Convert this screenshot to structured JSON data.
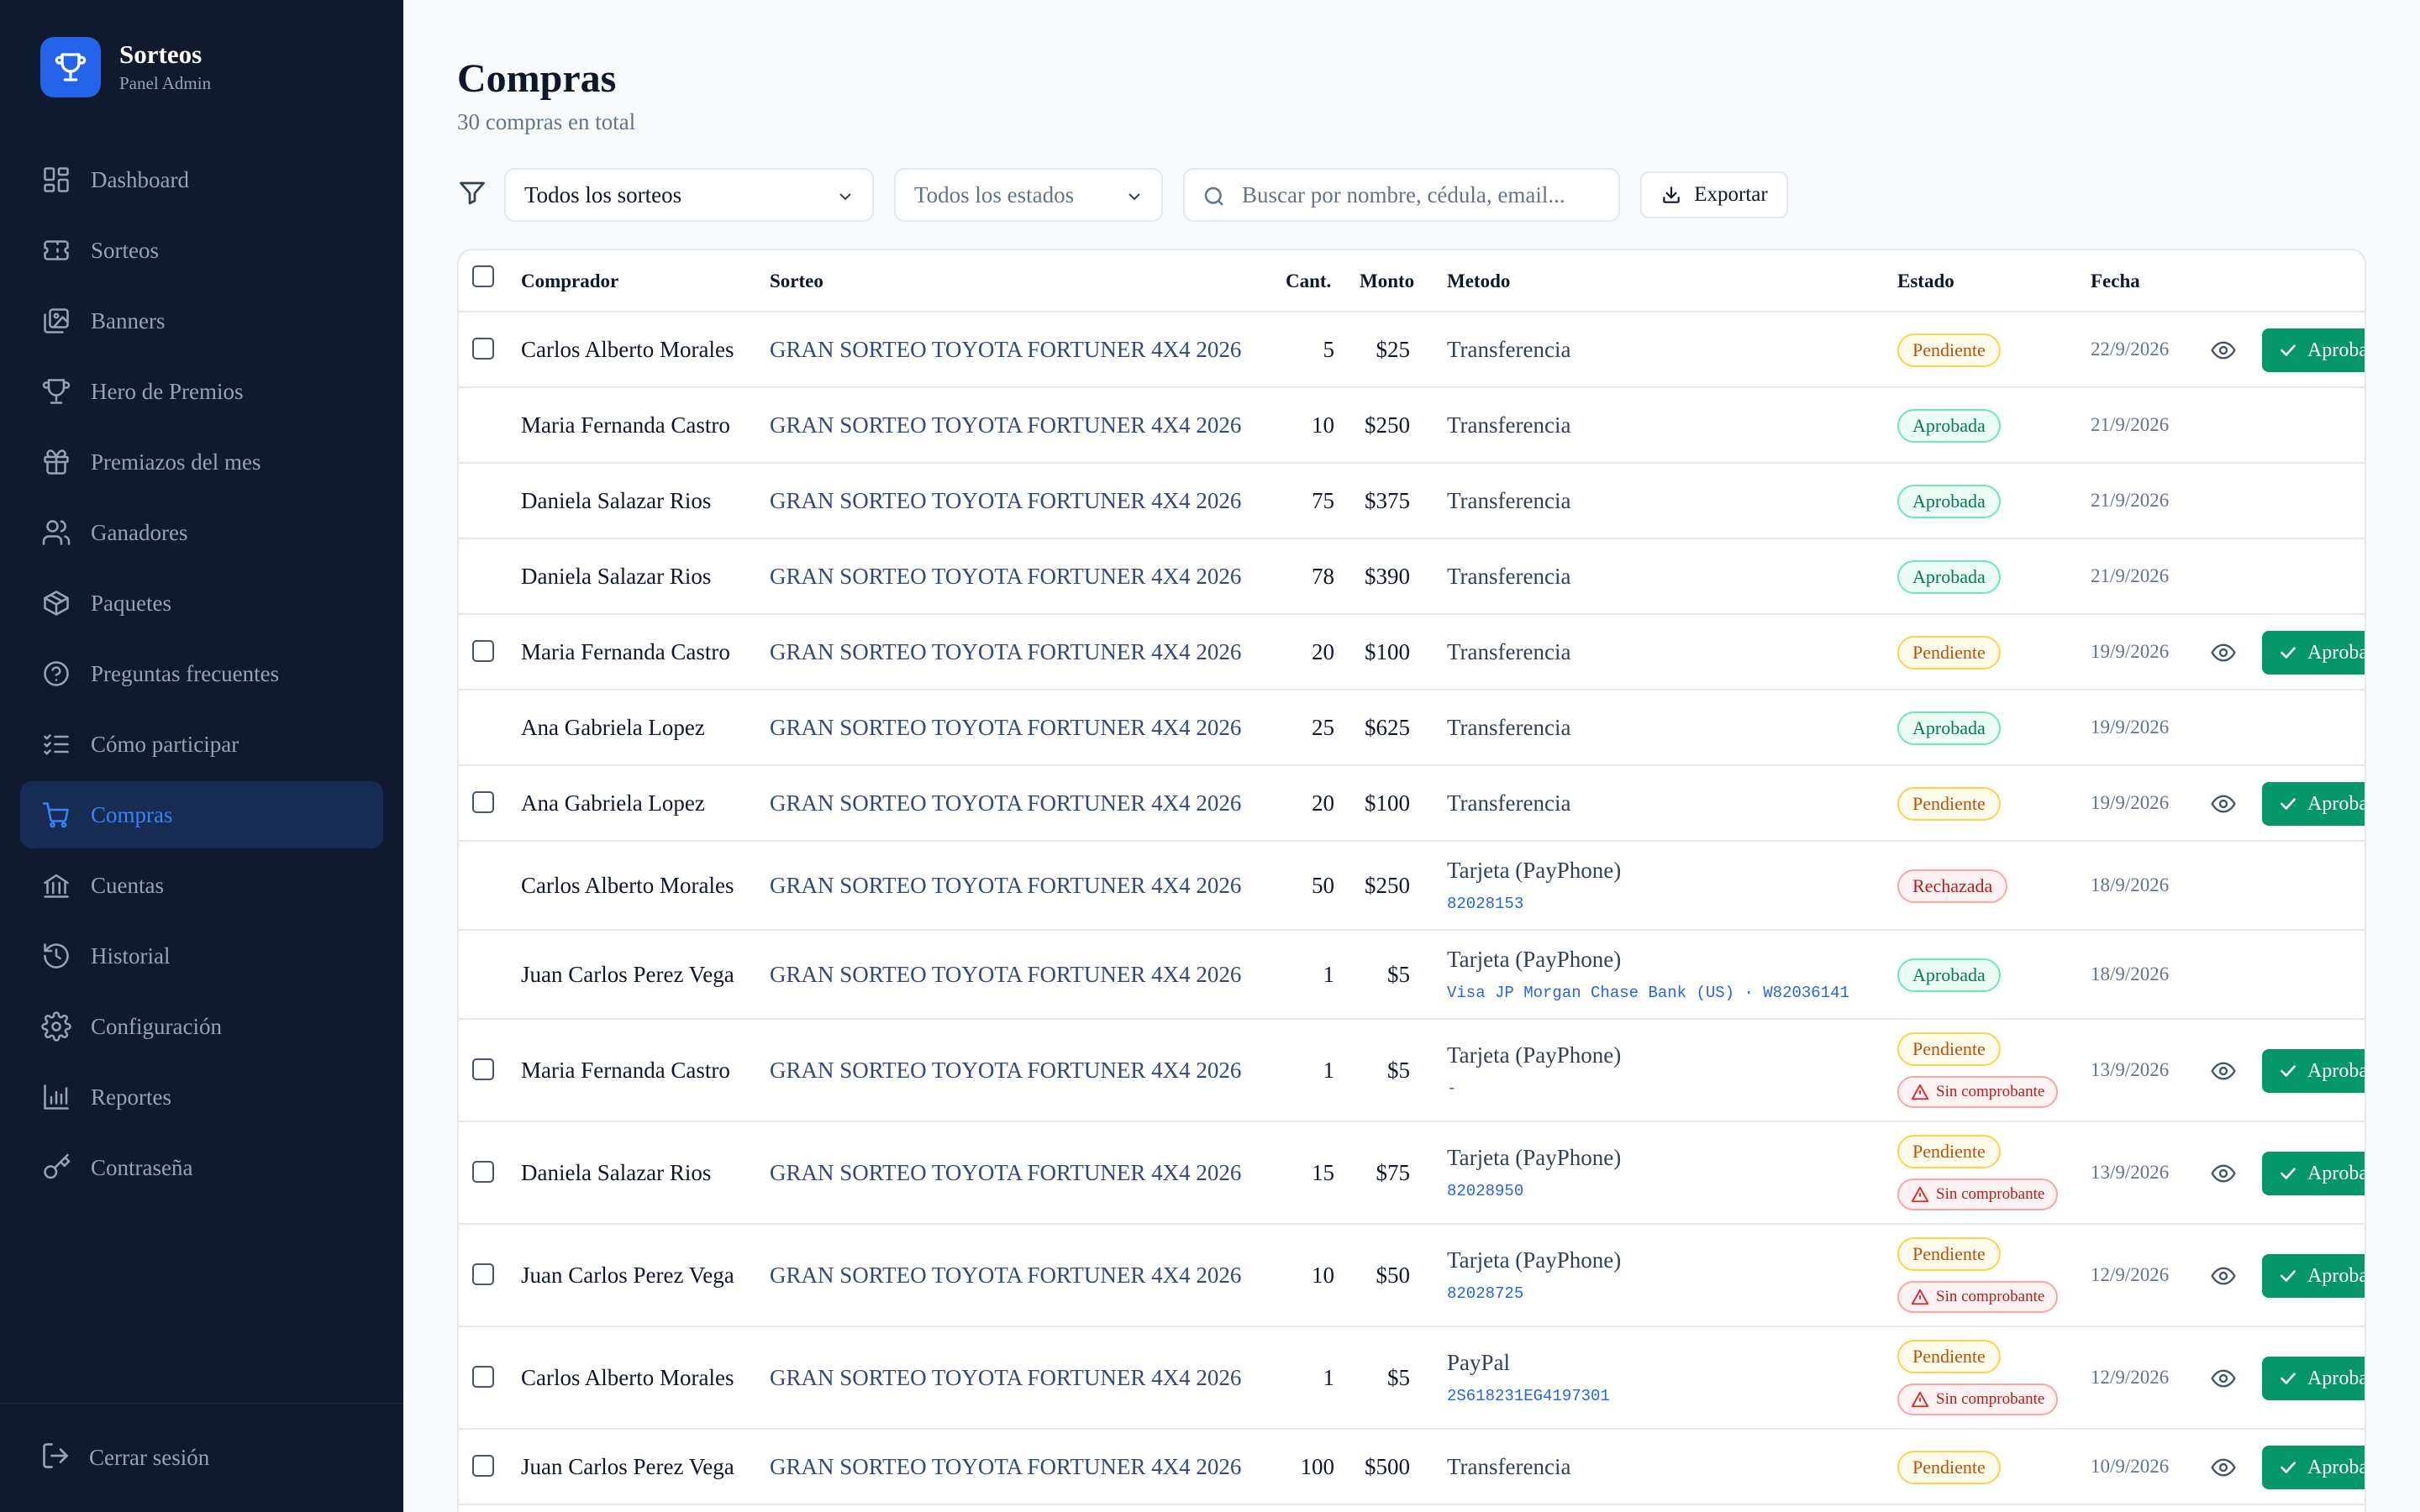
{
  "brand": {
    "title": "Sorteos",
    "subtitle": "Panel Admin"
  },
  "nav": [
    {
      "label": "Dashboard",
      "icon": "dashboard-icon"
    },
    {
      "label": "Sorteos",
      "icon": "ticket-icon"
    },
    {
      "label": "Banners",
      "icon": "images-icon"
    },
    {
      "label": "Hero de Premios",
      "icon": "trophy-icon"
    },
    {
      "label": "Premiazos del mes",
      "icon": "gift-icon"
    },
    {
      "label": "Ganadores",
      "icon": "users-icon"
    },
    {
      "label": "Paquetes",
      "icon": "package-icon"
    },
    {
      "label": "Preguntas frecuentes",
      "icon": "help-circle-icon"
    },
    {
      "label": "Cómo participar",
      "icon": "list-checks-icon"
    },
    {
      "label": "Compras",
      "icon": "cart-icon",
      "active": true
    },
    {
      "label": "Cuentas",
      "icon": "bank-icon"
    },
    {
      "label": "Historial",
      "icon": "history-icon"
    },
    {
      "label": "Configuración",
      "icon": "settings-icon"
    },
    {
      "label": "Reportes",
      "icon": "bar-chart-icon"
    },
    {
      "label": "Contraseña",
      "icon": "key-icon"
    }
  ],
  "logout_label": "Cerrar sesión",
  "page": {
    "title": "Compras",
    "subtitle": "30 compras en total"
  },
  "filters": {
    "sorteo_selected": "Todos los sorteos",
    "estado_selected": "Todos los estados",
    "search_placeholder": "Buscar por nombre, cédula, email...",
    "export_label": "Exportar"
  },
  "columns": {
    "buyer": "Comprador",
    "sorteo": "Sorteo",
    "cant": "Cant.",
    "monto": "Monto",
    "metodo": "Metodo",
    "estado": "Estado",
    "fecha": "Fecha"
  },
  "approve_label": "Aprobar",
  "no_receipt_label": "Sin comprobante",
  "status_colors": {
    "pendiente": "#b45309",
    "aprobada": "#047857",
    "rechazada": "#b91c1c",
    "accent": "#2563eb",
    "approve": "#059669"
  },
  "rows": [
    {
      "buyer": "Carlos Alberto Morales",
      "sorteo": "GRAN SORTEO TOYOTA FORTUNER 4X4 2026",
      "cant": "5",
      "monto": "$25",
      "metodo": "Transferencia",
      "ref": "",
      "estado": "Pendiente",
      "sin_comprobante": false,
      "fecha": "22/9/2026"
    },
    {
      "buyer": "Maria Fernanda Castro",
      "sorteo": "GRAN SORTEO TOYOTA FORTUNER 4X4 2026",
      "cant": "10",
      "monto": "$250",
      "metodo": "Transferencia",
      "ref": "",
      "estado": "Aprobada",
      "sin_comprobante": false,
      "fecha": "21/9/2026"
    },
    {
      "buyer": "Daniela Salazar Rios",
      "sorteo": "GRAN SORTEO TOYOTA FORTUNER 4X4 2026",
      "cant": "75",
      "monto": "$375",
      "metodo": "Transferencia",
      "ref": "",
      "estado": "Aprobada",
      "sin_comprobante": false,
      "fecha": "21/9/2026"
    },
    {
      "buyer": "Daniela Salazar Rios",
      "sorteo": "GRAN SORTEO TOYOTA FORTUNER 4X4 2026",
      "cant": "78",
      "monto": "$390",
      "metodo": "Transferencia",
      "ref": "",
      "estado": "Aprobada",
      "sin_comprobante": false,
      "fecha": "21/9/2026"
    },
    {
      "buyer": "Maria Fernanda Castro",
      "sorteo": "GRAN SORTEO TOYOTA FORTUNER 4X4 2026",
      "cant": "20",
      "monto": "$100",
      "metodo": "Transferencia",
      "ref": "",
      "estado": "Pendiente",
      "sin_comprobante": false,
      "fecha": "19/9/2026"
    },
    {
      "buyer": "Ana Gabriela Lopez",
      "sorteo": "GRAN SORTEO TOYOTA FORTUNER 4X4 2026",
      "cant": "25",
      "monto": "$625",
      "metodo": "Transferencia",
      "ref": "",
      "estado": "Aprobada",
      "sin_comprobante": false,
      "fecha": "19/9/2026"
    },
    {
      "buyer": "Ana Gabriela Lopez",
      "sorteo": "GRAN SORTEO TOYOTA FORTUNER 4X4 2026",
      "cant": "20",
      "monto": "$100",
      "metodo": "Transferencia",
      "ref": "",
      "estado": "Pendiente",
      "sin_comprobante": false,
      "fecha": "19/9/2026"
    },
    {
      "buyer": "Carlos Alberto Morales",
      "sorteo": "GRAN SORTEO TOYOTA FORTUNER 4X4 2026",
      "cant": "50",
      "monto": "$250",
      "metodo": "Tarjeta (PayPhone)",
      "ref": "82028153",
      "estado": "Rechazada",
      "sin_comprobante": false,
      "fecha": "18/9/2026"
    },
    {
      "buyer": "Juan Carlos Perez Vega",
      "sorteo": "GRAN SORTEO TOYOTA FORTUNER 4X4 2026",
      "cant": "1",
      "monto": "$5",
      "metodo": "Tarjeta (PayPhone)",
      "ref": "Visa JP Morgan Chase Bank (US) · W82036141",
      "estado": "Aprobada",
      "sin_comprobante": false,
      "fecha": "18/9/2026"
    },
    {
      "buyer": "Maria Fernanda Castro",
      "sorteo": "GRAN SORTEO TOYOTA FORTUNER 4X4 2026",
      "cant": "1",
      "monto": "$5",
      "metodo": "Tarjeta (PayPhone)",
      "ref": "-",
      "estado": "Pendiente",
      "sin_comprobante": true,
      "fecha": "13/9/2026"
    },
    {
      "buyer": "Daniela Salazar Rios",
      "sorteo": "GRAN SORTEO TOYOTA FORTUNER 4X4 2026",
      "cant": "15",
      "monto": "$75",
      "metodo": "Tarjeta (PayPhone)",
      "ref": "82028950",
      "estado": "Pendiente",
      "sin_comprobante": true,
      "fecha": "13/9/2026"
    },
    {
      "buyer": "Juan Carlos Perez Vega",
      "sorteo": "GRAN SORTEO TOYOTA FORTUNER 4X4 2026",
      "cant": "10",
      "monto": "$50",
      "metodo": "Tarjeta (PayPhone)",
      "ref": "82028725",
      "estado": "Pendiente",
      "sin_comprobante": true,
      "fecha": "12/9/2026"
    },
    {
      "buyer": "Carlos Alberto Morales",
      "sorteo": "GRAN SORTEO TOYOTA FORTUNER 4X4 2026",
      "cant": "1",
      "monto": "$5",
      "metodo": "PayPal",
      "ref": "2S618231EG4197301",
      "estado": "Pendiente",
      "sin_comprobante": true,
      "fecha": "12/9/2026"
    },
    {
      "buyer": "Juan Carlos Perez Vega",
      "sorteo": "GRAN SORTEO TOYOTA FORTUNER 4X4 2026",
      "cant": "100",
      "monto": "$500",
      "metodo": "Transferencia",
      "ref": "",
      "estado": "Pendiente",
      "sin_comprobante": false,
      "fecha": "10/9/2026"
    }
  ]
}
